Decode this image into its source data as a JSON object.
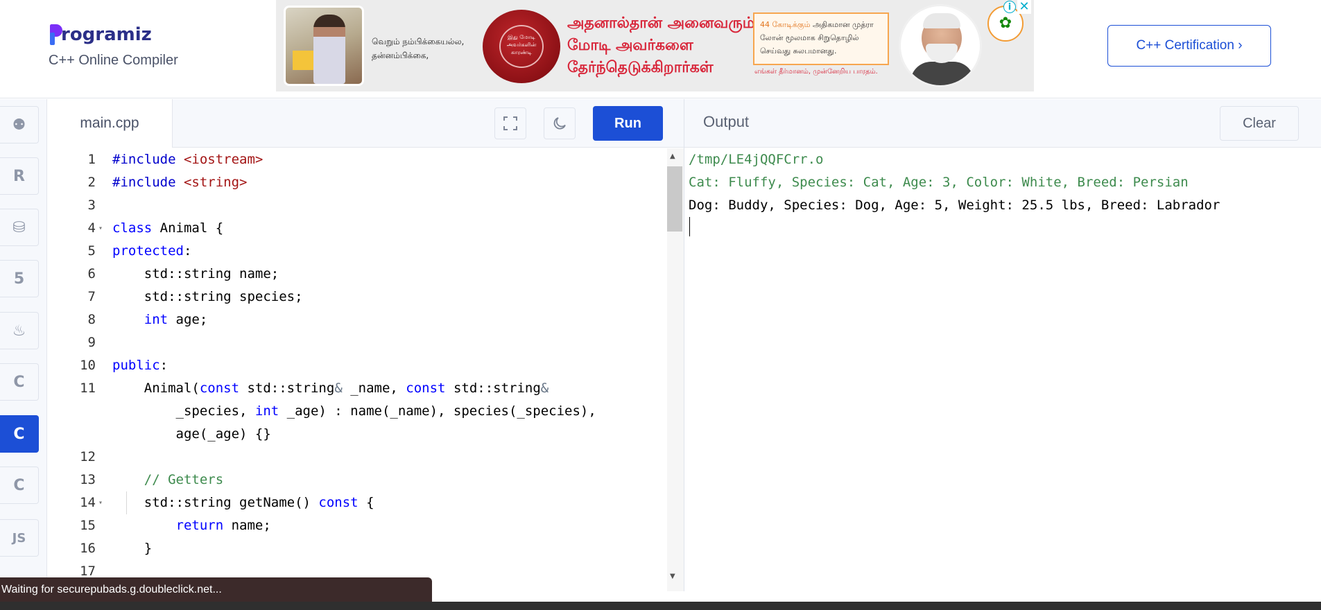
{
  "header": {
    "logo_text": "rogramiz",
    "subtitle": "C++ Online Compiler",
    "cert_button": "C++ Certification ›"
  },
  "ad": {
    "text1": "வெறும் நம்பிக்கையல்ல, தன்னம்பிக்கை,",
    "seal": "இது மோடி அவர்களின் காரண்டி",
    "headline": "அதனால்தான் அனைவரும் மோடி அவர்களை தேர்ந்தெடுக்கிறார்கள்",
    "box_highlight": "44 கோடிக்கும்",
    "box_text": "அதிகமான முத்ரா லோன் மூலமாக சிறுதொழில் செய்வது சுலபமானது.",
    "footer": "எங்கள் தீர்மானம், முன்னேறிய பாரதம்.",
    "info": "i",
    "close": "✕"
  },
  "sidebar": {
    "items": [
      {
        "icon": "python-icon",
        "glyph": "⚉",
        "active": false
      },
      {
        "icon": "r-icon",
        "glyph": "R",
        "active": false
      },
      {
        "icon": "sql-icon",
        "glyph": "⛁",
        "active": false
      },
      {
        "icon": "html5-icon",
        "glyph": "5",
        "active": false
      },
      {
        "icon": "java-icon",
        "glyph": "♨",
        "active": false
      },
      {
        "icon": "c-icon",
        "glyph": "C",
        "active": false
      },
      {
        "icon": "cpp-icon",
        "glyph": "C",
        "active": true
      },
      {
        "icon": "csharp-icon",
        "glyph": "C",
        "active": false
      },
      {
        "icon": "js-icon",
        "glyph": "JS",
        "active": false
      }
    ]
  },
  "editor": {
    "file_tab": "main.cpp",
    "run_label": "Run",
    "lines": [
      {
        "n": "1",
        "fold": false,
        "parts": [
          [
            "inc",
            "#include "
          ],
          [
            "str",
            "<iostream>"
          ]
        ]
      },
      {
        "n": "2",
        "fold": false,
        "parts": [
          [
            "inc",
            "#include "
          ],
          [
            "str",
            "<string>"
          ]
        ]
      },
      {
        "n": "3",
        "fold": false,
        "parts": []
      },
      {
        "n": "4",
        "fold": true,
        "parts": [
          [
            "kw",
            "class"
          ],
          [
            "",
            " Animal {"
          ]
        ]
      },
      {
        "n": "5",
        "fold": false,
        "parts": [
          [
            "kw",
            "protected"
          ],
          [
            "",
            ":"
          ]
        ]
      },
      {
        "n": "6",
        "fold": false,
        "parts": [
          [
            "",
            "    std::string name;"
          ]
        ]
      },
      {
        "n": "7",
        "fold": false,
        "parts": [
          [
            "",
            "    std::string species;"
          ]
        ]
      },
      {
        "n": "8",
        "fold": false,
        "parts": [
          [
            "",
            "    "
          ],
          [
            "kw",
            "int"
          ],
          [
            "",
            " age;"
          ]
        ]
      },
      {
        "n": "9",
        "fold": false,
        "parts": []
      },
      {
        "n": "10",
        "fold": false,
        "parts": [
          [
            "kw",
            "public"
          ],
          [
            "",
            ":"
          ]
        ]
      },
      {
        "n": "11",
        "fold": false,
        "parts": [
          [
            "",
            "    Animal("
          ],
          [
            "kw",
            "const"
          ],
          [
            "",
            " std::string"
          ],
          [
            "amp",
            "&"
          ],
          [
            "",
            " _name, "
          ],
          [
            "kw",
            "const"
          ],
          [
            "",
            " std::string"
          ],
          [
            "amp",
            "&"
          ]
        ]
      },
      {
        "n": "",
        "fold": false,
        "parts": [
          [
            "",
            "        _species, "
          ],
          [
            "kw",
            "int"
          ],
          [
            "",
            " _age) : name(_name), species(_species),"
          ]
        ]
      },
      {
        "n": "",
        "fold": false,
        "parts": [
          [
            "",
            "        age(_age) {}"
          ]
        ]
      },
      {
        "n": "12",
        "fold": false,
        "parts": []
      },
      {
        "n": "13",
        "fold": false,
        "parts": [
          [
            "",
            "    "
          ],
          [
            "cmt",
            "// Getters"
          ]
        ]
      },
      {
        "n": "14",
        "fold": true,
        "parts": [
          [
            "",
            "    std::string getName() "
          ],
          [
            "kw",
            "const"
          ],
          [
            "",
            " {"
          ]
        ]
      },
      {
        "n": "15",
        "fold": false,
        "parts": [
          [
            "",
            "        "
          ],
          [
            "kw",
            "return"
          ],
          [
            "",
            " name;"
          ]
        ]
      },
      {
        "n": "16",
        "fold": false,
        "parts": [
          [
            "",
            "    }"
          ]
        ]
      },
      {
        "n": "17",
        "fold": false,
        "parts": []
      }
    ]
  },
  "output": {
    "title": "Output",
    "clear_label": "Clear",
    "lines": [
      {
        "cls": "out-path",
        "text": "/tmp/LE4jQQFCrr.o"
      },
      {
        "cls": "out-green",
        "text": "Cat: Fluffy, Species: Cat, Age: 3, Color: White, Breed: Persian"
      },
      {
        "cls": "out-black",
        "text": "Dog: Buddy, Species: Dog, Age: 5, Weight: 25.5 lbs, Breed: Labrador"
      }
    ]
  },
  "status": {
    "text": "Waiting for securepubads.g.doubleclick.net..."
  },
  "colors": {
    "brand_blue": "#1c4fd6",
    "logo_purple": "#7b2ff7",
    "output_green": "#3e8b4e"
  }
}
